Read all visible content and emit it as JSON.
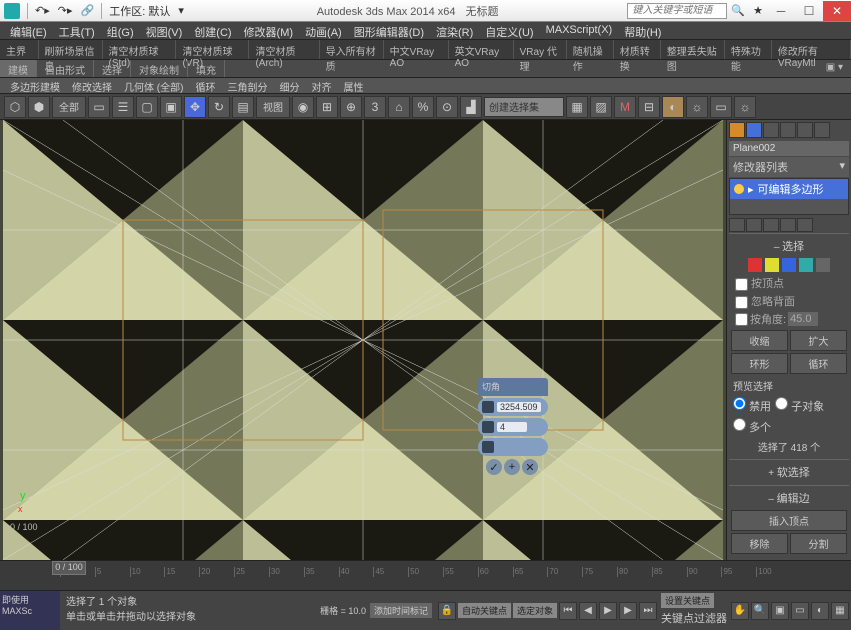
{
  "title": {
    "app": "Autodesk 3ds Max 2014 x64",
    "doc": "无标题",
    "workspace_label": "工作区: 默认",
    "search_ph": "键入关键字或短语"
  },
  "menu": [
    "编辑(E)",
    "工具(T)",
    "组(G)",
    "视图(V)",
    "创建(C)",
    "修改器(M)",
    "动画(A)",
    "图形编辑器(D)",
    "渲染(R)",
    "自定义(U)",
    "MAXScript(X)",
    "帮助(H)"
  ],
  "tabs": [
    "主界面",
    "刷新场景信息",
    "清空材质球(Std)",
    "清空材质球(VR)",
    "清空材质(Arch)",
    "导入所有材质",
    "中文VRay AO",
    "英文VRay AO",
    "VRay 代理",
    "随机操作",
    "材质转换",
    "整理丢失贴图",
    "特殊功能",
    "修改所有VRayMtl"
  ],
  "ribbon": [
    "建模",
    "自由形式",
    "选择",
    "对象绘制",
    "填充"
  ],
  "subr": [
    "多边形建模",
    "修改选择",
    "几何体 (全部)",
    "循环",
    "三角剖分",
    "细分",
    "对齐",
    "属性"
  ],
  "toolbar": {
    "all": "全部",
    "view": "视图",
    "num": "3",
    "creationset": "创建选择集"
  },
  "viewport": {
    "caddy_title": "切角",
    "val1": "3254.509",
    "val2": "4",
    "frame_label": "0 / 100"
  },
  "side": {
    "object": "Plane002",
    "modlist": "修改器列表",
    "stack_item": "可编辑多边形",
    "sel_title": "选择",
    "by_vertex": "按顶点",
    "ignore_back": "忽略背面",
    "by_angle": "按角度:",
    "angle": "45.0",
    "shrink": "收缩",
    "grow": "扩大",
    "ring": "环形",
    "loop": "循环",
    "preview": "预览选择",
    "off": "禁用",
    "subobj": "子对象",
    "multi": "多个",
    "selected": "选择了 418 个",
    "soft": "软选择",
    "edit_edge": "编辑边",
    "insert_v": "插入顶点",
    "remove": "移除",
    "split": "分割"
  },
  "timeline": {
    "slider": "0 / 100",
    "ticks": [
      "0",
      "5",
      "10",
      "15",
      "20",
      "25",
      "30",
      "35",
      "40",
      "45",
      "50",
      "55",
      "60",
      "65",
      "70",
      "75",
      "80",
      "85",
      "90",
      "95",
      "100"
    ]
  },
  "status": {
    "line1": "选择了 1 个对象",
    "line2": "单击或单击并拖动以选择对象",
    "maxs": "即使用 MAXSc",
    "grid": "栅格 = 10.0",
    "auto": "自动关键点",
    "sel_obj": "选定对象",
    "set_key": "设置关键点",
    "key_filter": "关键点过滤器",
    "add_time": "添加时间标记"
  }
}
